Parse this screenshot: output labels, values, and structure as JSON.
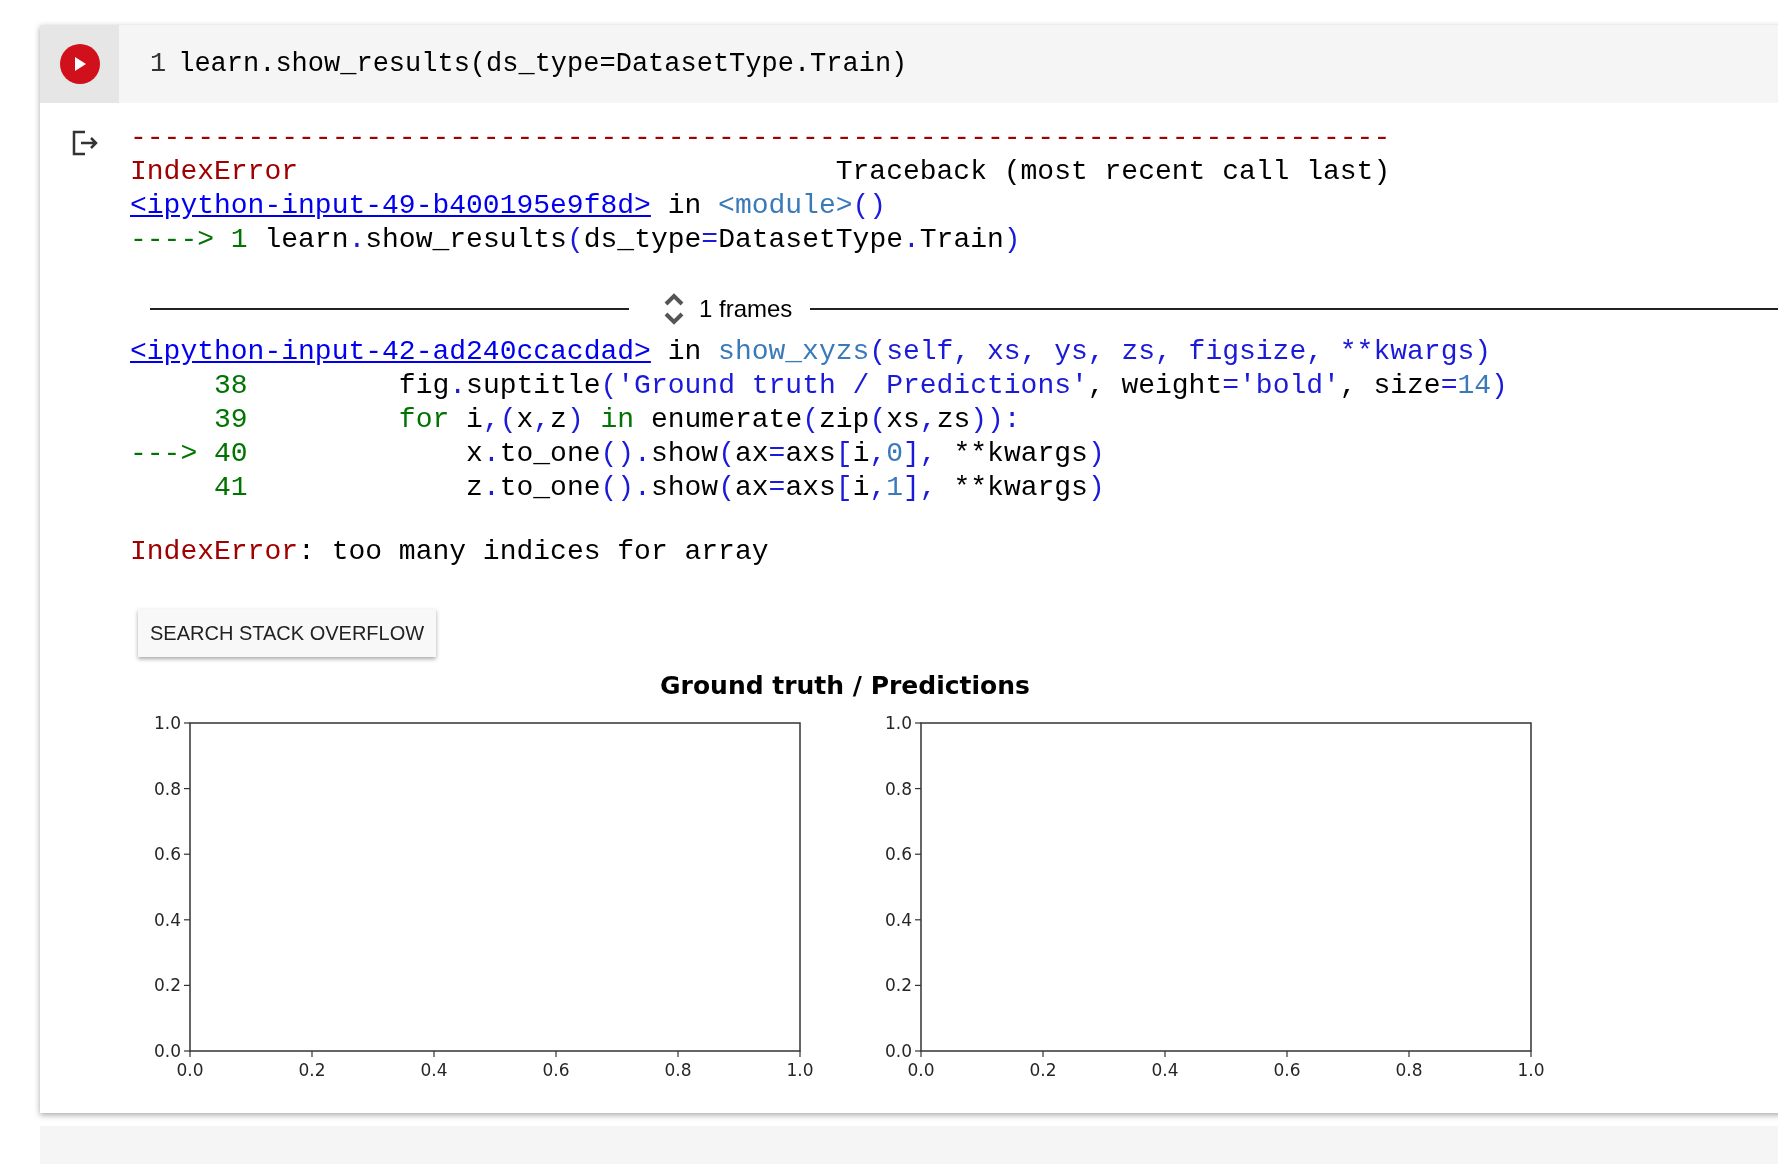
{
  "cell": {
    "line_number": "1",
    "code": "learn.show_results(ds_type=DatasetType.Train)"
  },
  "output": {
    "lines": [
      {
        "kind": "code",
        "tokens": [
          {
            "kind": "error",
            "text": "---------------------------------------------------------------------------"
          }
        ]
      },
      {
        "kind": "code",
        "tokens": [
          {
            "kind": "error",
            "text": "IndexError"
          },
          {
            "kind": "plain",
            "text": "                                Traceback (most recent call last)"
          }
        ]
      },
      {
        "kind": "code",
        "tokens": [
          {
            "kind": "link",
            "text": "<ipython-input-49-b400195e9f8d>"
          },
          {
            "kind": "plain",
            "text": " in "
          },
          {
            "kind": "module",
            "text": "<module>"
          },
          {
            "kind": "op",
            "text": "()"
          }
        ]
      },
      {
        "kind": "code",
        "tokens": [
          {
            "kind": "green",
            "text": "----> 1"
          },
          {
            "kind": "plain",
            "text": " learn"
          },
          {
            "kind": "op",
            "text": "."
          },
          {
            "kind": "plain",
            "text": "show_results"
          },
          {
            "kind": "op",
            "text": "("
          },
          {
            "kind": "plain",
            "text": "ds_type"
          },
          {
            "kind": "op",
            "text": "="
          },
          {
            "kind": "plain",
            "text": "DatasetType"
          },
          {
            "kind": "op",
            "text": "."
          },
          {
            "kind": "plain",
            "text": "Train"
          },
          {
            "kind": "op",
            "text": ")"
          }
        ]
      },
      {
        "kind": "gap"
      },
      {
        "kind": "frames",
        "label": "1 frames"
      },
      {
        "kind": "code",
        "tokens": [
          {
            "kind": "link",
            "text": "<ipython-input-42-ad240ccacdad>"
          },
          {
            "kind": "plain",
            "text": " in "
          },
          {
            "kind": "module",
            "text": "show_xyzs"
          },
          {
            "kind": "op",
            "text": "(self, xs, ys, zs, figsize, **kwargs)"
          }
        ]
      },
      {
        "kind": "code",
        "tokens": [
          {
            "kind": "green",
            "text": "     38"
          },
          {
            "kind": "plain",
            "text": "         fig"
          },
          {
            "kind": "op",
            "text": "."
          },
          {
            "kind": "plain",
            "text": "suptitle"
          },
          {
            "kind": "op",
            "text": "("
          },
          {
            "kind": "op",
            "text": "'Ground truth / Predictions'"
          },
          {
            "kind": "plain",
            "text": ", weight"
          },
          {
            "kind": "op",
            "text": "="
          },
          {
            "kind": "op",
            "text": "'bold'"
          },
          {
            "kind": "plain",
            "text": ", size"
          },
          {
            "kind": "op",
            "text": "="
          },
          {
            "kind": "module",
            "text": "14"
          },
          {
            "kind": "op",
            "text": ")"
          }
        ]
      },
      {
        "kind": "code",
        "tokens": [
          {
            "kind": "green",
            "text": "     39"
          },
          {
            "kind": "green",
            "text": "         for"
          },
          {
            "kind": "plain",
            "text": " i"
          },
          {
            "kind": "op",
            "text": ",("
          },
          {
            "kind": "plain",
            "text": "x"
          },
          {
            "kind": "op",
            "text": ","
          },
          {
            "kind": "plain",
            "text": "z"
          },
          {
            "kind": "op",
            "text": ")"
          },
          {
            "kind": "green",
            "text": " in"
          },
          {
            "kind": "plain",
            "text": " enumerate"
          },
          {
            "kind": "op",
            "text": "("
          },
          {
            "kind": "plain",
            "text": "zip"
          },
          {
            "kind": "op",
            "text": "("
          },
          {
            "kind": "plain",
            "text": "xs"
          },
          {
            "kind": "op",
            "text": ","
          },
          {
            "kind": "plain",
            "text": "zs"
          },
          {
            "kind": "op",
            "text": ")):"
          }
        ]
      },
      {
        "kind": "code",
        "tokens": [
          {
            "kind": "green",
            "text": "---> 40"
          },
          {
            "kind": "plain",
            "text": "             x"
          },
          {
            "kind": "op",
            "text": "."
          },
          {
            "kind": "plain",
            "text": "to_one"
          },
          {
            "kind": "op",
            "text": "()."
          },
          {
            "kind": "plain",
            "text": "show"
          },
          {
            "kind": "op",
            "text": "("
          },
          {
            "kind": "plain",
            "text": "ax"
          },
          {
            "kind": "op",
            "text": "="
          },
          {
            "kind": "plain",
            "text": "axs"
          },
          {
            "kind": "op",
            "text": "["
          },
          {
            "kind": "plain",
            "text": "i"
          },
          {
            "kind": "op",
            "text": ","
          },
          {
            "kind": "module",
            "text": "0"
          },
          {
            "kind": "op",
            "text": "],"
          },
          {
            "kind": "plain",
            "text": " **kwargs"
          },
          {
            "kind": "op",
            "text": ")"
          }
        ]
      },
      {
        "kind": "code",
        "tokens": [
          {
            "kind": "green",
            "text": "     41"
          },
          {
            "kind": "plain",
            "text": "             z"
          },
          {
            "kind": "op",
            "text": "."
          },
          {
            "kind": "plain",
            "text": "to_one"
          },
          {
            "kind": "op",
            "text": "()."
          },
          {
            "kind": "plain",
            "text": "show"
          },
          {
            "kind": "op",
            "text": "("
          },
          {
            "kind": "plain",
            "text": "ax"
          },
          {
            "kind": "op",
            "text": "="
          },
          {
            "kind": "plain",
            "text": "axs"
          },
          {
            "kind": "op",
            "text": "["
          },
          {
            "kind": "plain",
            "text": "i"
          },
          {
            "kind": "op",
            "text": ","
          },
          {
            "kind": "module",
            "text": "1"
          },
          {
            "kind": "op",
            "text": "],"
          },
          {
            "kind": "plain",
            "text": " **kwargs"
          },
          {
            "kind": "op",
            "text": ")"
          }
        ]
      },
      {
        "kind": "gap"
      },
      {
        "kind": "code",
        "tokens": [
          {
            "kind": "error",
            "text": "IndexError"
          },
          {
            "kind": "plain",
            "text": ": too many indices for array"
          }
        ]
      }
    ],
    "button": "SEARCH STACK OVERFLOW",
    "figure": {
      "title": "Ground truth / Predictions",
      "charts": [
        {
          "chart_data": {
            "type": "line",
            "xlim": [
              0,
              1
            ],
            "ylim": [
              0,
              1
            ],
            "xticks": [
              {
                "value": 0,
                "label": "0.0"
              },
              {
                "value": 0.2,
                "label": "0.2"
              },
              {
                "value": 0.4,
                "label": "0.4"
              },
              {
                "value": 0.6,
                "label": "0.6"
              },
              {
                "value": 0.8,
                "label": "0.8"
              },
              {
                "value": 1,
                "label": "1.0"
              }
            ],
            "yticks": [
              {
                "value": 0,
                "label": "0.0"
              },
              {
                "value": 0.2,
                "label": "0.2"
              },
              {
                "value": 0.4,
                "label": "0.4"
              },
              {
                "value": 0.6,
                "label": "0.6"
              },
              {
                "value": 0.8,
                "label": "0.8"
              },
              {
                "value": 1,
                "label": "1.0"
              }
            ]
          }
        },
        {
          "chart_data": {
            "type": "line",
            "xlim": [
              0,
              1
            ],
            "ylim": [
              0,
              1
            ],
            "xticks": [
              {
                "value": 0,
                "label": "0.0"
              },
              {
                "value": 0.2,
                "label": "0.2"
              },
              {
                "value": 0.4,
                "label": "0.4"
              },
              {
                "value": 0.6,
                "label": "0.6"
              },
              {
                "value": 0.8,
                "label": "0.8"
              },
              {
                "value": 1,
                "label": "1.0"
              }
            ],
            "yticks": [
              {
                "value": 0,
                "label": "0.0"
              },
              {
                "value": 0.2,
                "label": "0.2"
              },
              {
                "value": 0.4,
                "label": "0.4"
              },
              {
                "value": 0.6,
                "label": "0.6"
              },
              {
                "value": 0.8,
                "label": "0.8"
              },
              {
                "value": 1,
                "label": "1.0"
              }
            ]
          }
        }
      ]
    }
  }
}
